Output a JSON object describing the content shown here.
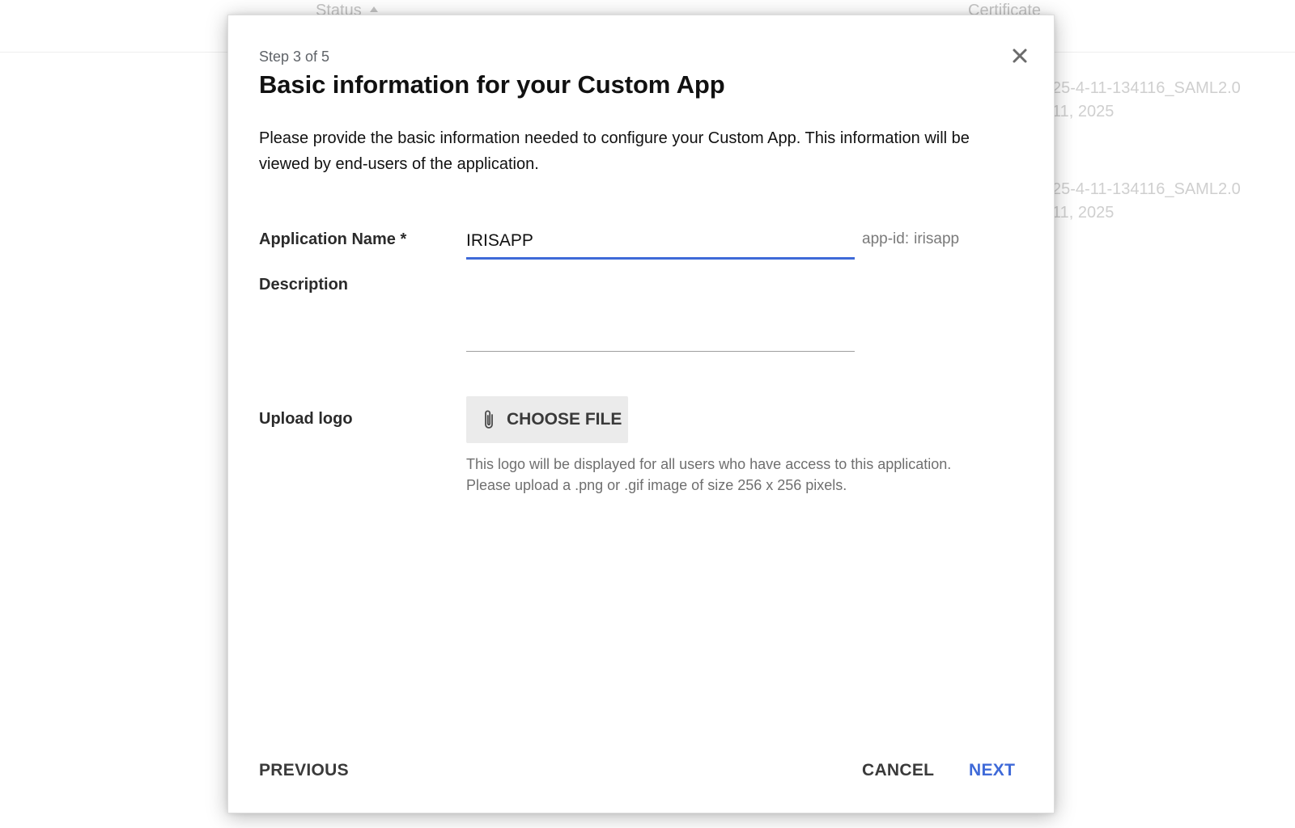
{
  "background": {
    "columns": {
      "status": "Status",
      "certificate": "Certificate"
    },
    "rows": [
      {
        "line1": "25-4-11-134116_SAML2.0",
        "line2": "11, 2025"
      },
      {
        "line1": "25-4-11-134116_SAML2.0",
        "line2": "11, 2025"
      }
    ]
  },
  "dialog": {
    "step": "Step 3 of 5",
    "title": "Basic information for your Custom App",
    "intro": "Please provide the basic information needed to configure your Custom App. This information will be viewed by end-users of the application.",
    "fields": {
      "app_name": {
        "label": "Application Name *",
        "value": "IRISAPP",
        "app_id_label": "app-id:",
        "app_id_value": "irisapp"
      },
      "description": {
        "label": "Description",
        "value": ""
      },
      "logo": {
        "label": "Upload logo",
        "button_label": "CHOOSE FILE",
        "hint_line1": "This logo will be displayed for all users who have access to this application.",
        "hint_line2": "Please upload a .png or .gif image of size 256 x 256 pixels."
      }
    },
    "footer": {
      "previous": "PREVIOUS",
      "cancel": "CANCEL",
      "next": "NEXT"
    }
  },
  "colors": {
    "accent": "#3f6ad8",
    "text": "#111111",
    "muted": "#6f6f6f",
    "button_bg": "#ebebeb"
  },
  "icons": {
    "close": "close-icon",
    "attach": "paperclip-icon",
    "sort": "sort-up-icon"
  }
}
